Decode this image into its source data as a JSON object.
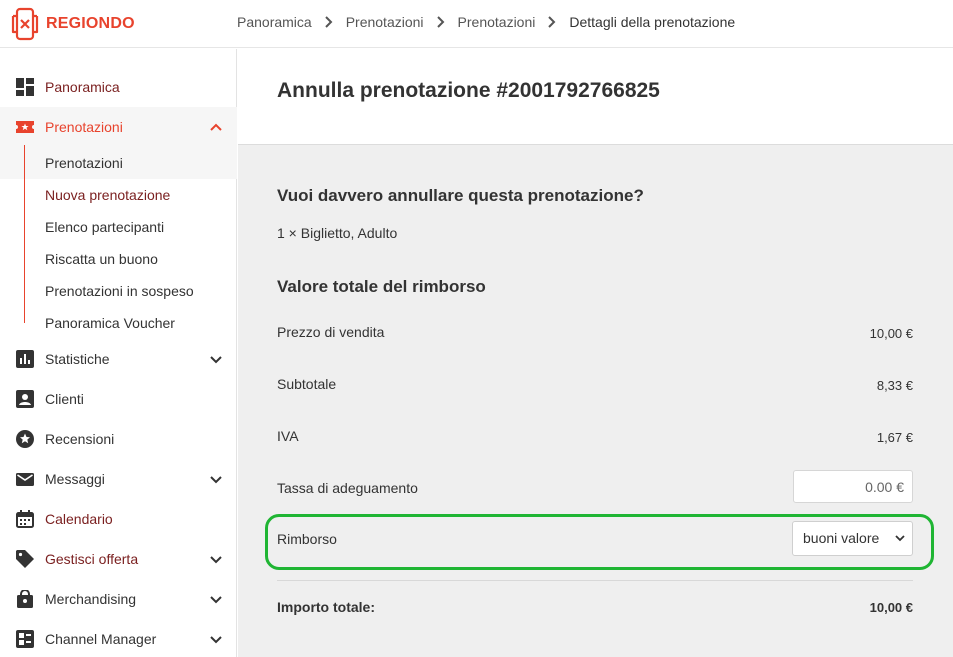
{
  "app": {
    "logo_text": "REGIONDO",
    "accent": "#e8432d"
  },
  "breadcrumb": [
    "Panoramica",
    "Prenotazioni",
    "Prenotazioni",
    "Dettagli della prenotazione"
  ],
  "sidebar": {
    "items": [
      {
        "label": "Panoramica",
        "icon": "dashboard-icon"
      },
      {
        "label": "Prenotazioni",
        "icon": "ticket-icon"
      },
      {
        "label": "Statistiche",
        "icon": "chart-icon"
      },
      {
        "label": "Clienti",
        "icon": "person-icon"
      },
      {
        "label": "Recensioni",
        "icon": "star-icon"
      },
      {
        "label": "Messaggi",
        "icon": "mail-icon"
      },
      {
        "label": "Calendario",
        "icon": "calendar-icon"
      },
      {
        "label": "Gestisci offerta",
        "icon": "tag-icon"
      },
      {
        "label": "Merchandising",
        "icon": "bag-icon"
      },
      {
        "label": "Channel Manager",
        "icon": "channel-icon"
      }
    ],
    "sub_items": [
      "Prenotazioni",
      "Nuova prenotazione",
      "Elenco partecipanti",
      "Riscatta un buono",
      "Prenotazioni in sospeso",
      "Panoramica Voucher"
    ]
  },
  "main": {
    "title": "Annulla prenotazione #2001792766825",
    "question": "Vuoi davvero annullare questa prenotazione?",
    "ticket": "1 × Biglietto, Adulto",
    "section_title": "Valore totale del rimborso",
    "rows": [
      {
        "label": "Prezzo di vendita",
        "value": "10,00 €"
      },
      {
        "label": "Subtotale",
        "value": "8,33 €"
      },
      {
        "label": "IVA",
        "value": "1,67 €"
      }
    ],
    "fee": {
      "label": "Tassa di adeguamento",
      "value": "0.00 €"
    },
    "refund": {
      "label": "Rimborso",
      "selected": "buoni valore"
    },
    "total": {
      "label": "Importo totale:",
      "value": "10,00 €"
    }
  }
}
